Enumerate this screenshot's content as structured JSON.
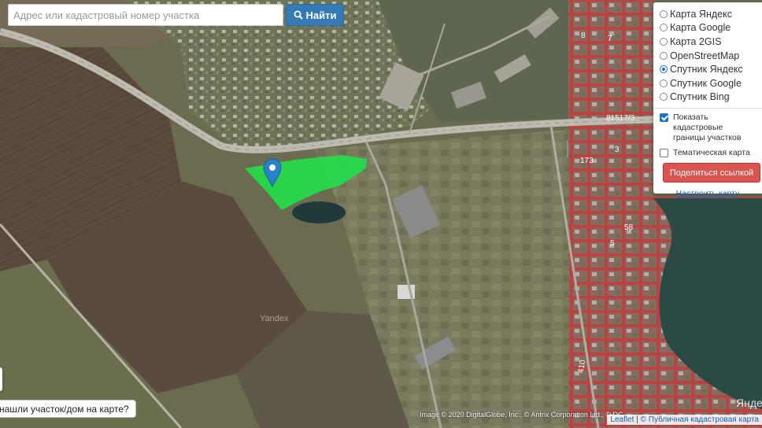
{
  "search": {
    "placeholder": "Адрес или кадастровый номер участка",
    "button_label": "Найти",
    "button_icon": "search-icon"
  },
  "layers": {
    "options": [
      {
        "label": "Карта Яндекс",
        "checked": false
      },
      {
        "label": "Карта Google",
        "checked": false
      },
      {
        "label": "Карта 2GIS",
        "checked": false
      },
      {
        "label": "OpenStreetMap",
        "checked": false
      },
      {
        "label": "Спутник Яндекс",
        "checked": true
      },
      {
        "label": "Спутник Google",
        "checked": false
      },
      {
        "label": "Спутник Bing",
        "checked": false
      }
    ],
    "show_cadastral_label": "Показать кадастровые границы участков",
    "show_cadastral": true,
    "thematic_label": "Тематическая карта",
    "thematic": false,
    "share_label": "Поделиться ссылкой",
    "config_label": "Настроить карту"
  },
  "map": {
    "parcel_labels": [
      "81517/3",
      "173",
      "7",
      "3",
      "58",
      "5",
      "410",
      "8"
    ],
    "watermark": "Yandex",
    "brand_partial": "Янде",
    "colors": {
      "selected_parcel": "#22e04a",
      "cadastral_border": "#d22a2a",
      "marker": "#2a81cb"
    }
  },
  "bottom": {
    "found_label": "нашли участок/дом на карте?",
    "imagery_attribution": "Image © 2020 DigitalGlobe, Inc., © Antrix Corporation Ltd., © DG",
    "leaflet_label": "Leaflet",
    "separator": "|",
    "cadastral_map_label": "© Публичная кадастровая карта"
  }
}
